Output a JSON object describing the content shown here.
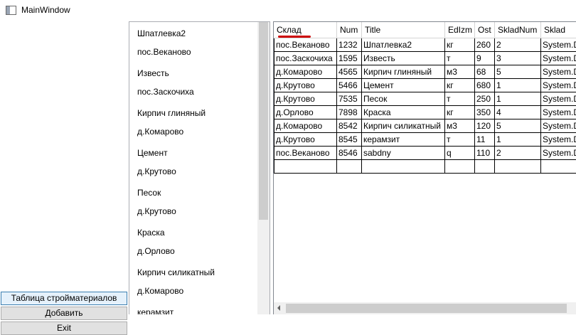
{
  "window": {
    "title": "MainWindow"
  },
  "left_buttons": [
    {
      "label": "Таблица стройматериалов"
    },
    {
      "label": "Добавить"
    },
    {
      "label": "Exit"
    }
  ],
  "list_items": [
    "Шпатлевка2",
    "пос.Веканово",
    "Известь",
    "пос.Заскочиха",
    "Кирпич глиняный",
    "д.Комарово",
    "Цемент",
    "д.Крутово",
    "Песок",
    "д.Крутово",
    "Краска",
    "д.Орлово",
    "Кирпич силикатный",
    "д.Комарово",
    "керамзит"
  ],
  "grid": {
    "columns": [
      "Склад",
      "Num",
      "Title",
      "EdIzm",
      "Ost",
      "SkladNum",
      "Sklad"
    ],
    "rows": [
      [
        "пос.Веканово",
        "1232",
        "Шпатлевка2",
        "кг",
        "260",
        "2",
        "System.D"
      ],
      [
        "пос.Заскочиха",
        "1595",
        "Известь",
        "т",
        "9",
        "3",
        "System.D"
      ],
      [
        "д.Комарово",
        "4565",
        "Кирпич глиняный",
        "м3",
        "68",
        "5",
        "System.D"
      ],
      [
        "д.Крутово",
        "5466",
        "Цемент",
        "кг",
        "680",
        "1",
        "System.D"
      ],
      [
        "д.Крутово",
        "7535",
        "Песок",
        "т",
        "250",
        "1",
        "System.D"
      ],
      [
        "д.Орлово",
        "7898",
        "Краска",
        "кг",
        "350",
        "4",
        "System.D"
      ],
      [
        "д.Комарово",
        "8542",
        "Кирпич силикатный",
        "м3",
        "120",
        "5",
        "System.D"
      ],
      [
        "д.Крутово",
        "8545",
        "керамзит",
        "т",
        "11",
        "1",
        "System.D"
      ],
      [
        "пос.Веканово",
        "8546",
        "sabdny",
        "q",
        "110",
        "2",
        "System.D"
      ],
      [
        "",
        "",
        "",
        "",
        "",
        "",
        ""
      ]
    ]
  }
}
